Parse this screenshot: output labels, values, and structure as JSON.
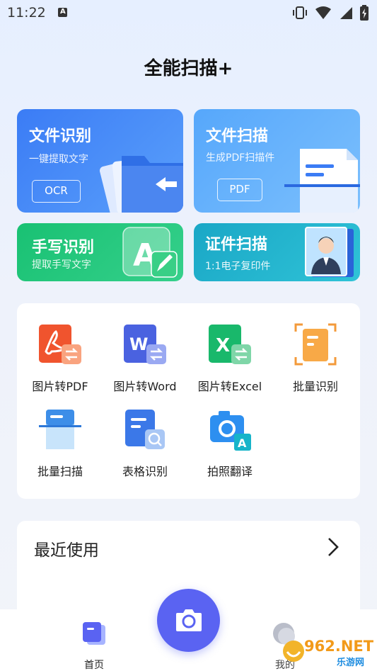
{
  "status_bar": {
    "time": "11:22",
    "notif_letter": "A"
  },
  "app": {
    "title": "全能扫描+"
  },
  "cards": {
    "ocr": {
      "title": "文件识别",
      "subtitle": "一键提取文字",
      "chip": "OCR"
    },
    "scan": {
      "title": "文件扫描",
      "subtitle": "生成PDF扫描件",
      "chip": "PDF"
    },
    "handwriting": {
      "title": "手写识别",
      "subtitle": "提取手写文字"
    },
    "certificate": {
      "title": "证件扫描",
      "subtitle": "1:1电子复印件"
    }
  },
  "tools": [
    {
      "label": "图片转PDF",
      "icon": "pdf-convert-icon"
    },
    {
      "label": "图片转Word",
      "icon": "word-convert-icon"
    },
    {
      "label": "图片转Excel",
      "icon": "excel-convert-icon"
    },
    {
      "label": "批量识别",
      "icon": "batch-ocr-icon"
    },
    {
      "label": "批量扫描",
      "icon": "batch-scan-icon"
    },
    {
      "label": "表格识别",
      "icon": "table-ocr-icon"
    },
    {
      "label": "拍照翻译",
      "icon": "photo-translate-icon"
    }
  ],
  "recent": {
    "title": "最近使用"
  },
  "nav": {
    "home": "首页",
    "mine": "我的"
  },
  "watermark": {
    "brand": "962.NET",
    "sub": "乐游网"
  },
  "colors": {
    "primary": "#5a63f2",
    "ocr_card": "#3b7cf5",
    "scan_card": "#56a7fb",
    "hand_card": "#19c173",
    "cert_card": "#1aa7c6"
  }
}
